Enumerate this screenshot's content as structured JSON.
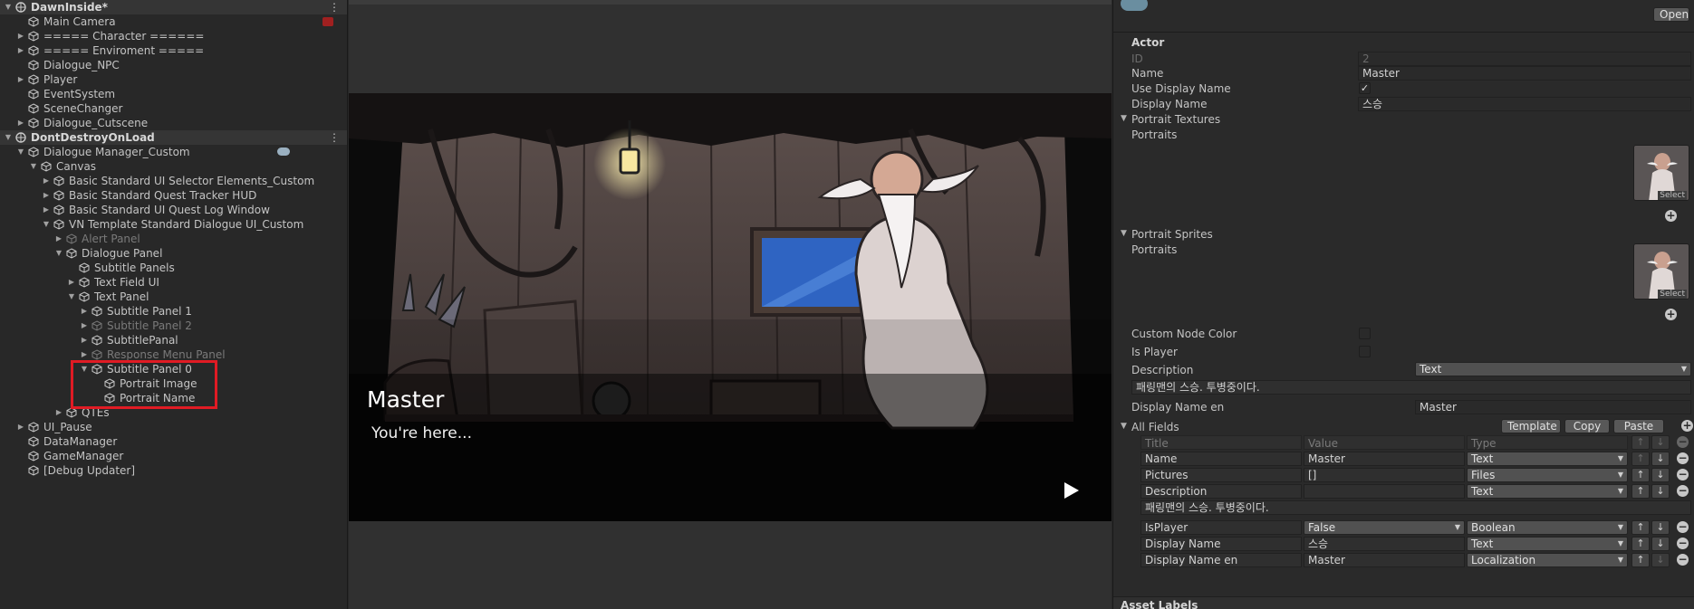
{
  "hierarchy": {
    "rows": [
      {
        "label": "DawnInside*",
        "indent": 0,
        "arrow": "▼",
        "scene": true,
        "bold": true,
        "menu": "⋮"
      },
      {
        "label": "Main Camera",
        "indent": 1,
        "arrow": "",
        "badge": true
      },
      {
        "label": "===== Character ======",
        "indent": 1,
        "arrow": "▶"
      },
      {
        "label": "===== Enviroment =====",
        "indent": 1,
        "arrow": "▶"
      },
      {
        "label": "Dialogue_NPC",
        "indent": 1,
        "arrow": ""
      },
      {
        "label": "Player",
        "indent": 1,
        "arrow": "▶"
      },
      {
        "label": "EventSystem",
        "indent": 1,
        "arrow": ""
      },
      {
        "label": "SceneChanger",
        "indent": 1,
        "arrow": ""
      },
      {
        "label": "Dialogue_Cutscene",
        "indent": 1,
        "arrow": "▶"
      },
      {
        "label": "DontDestroyOnLoad",
        "indent": 0,
        "arrow": "▼",
        "scene": true,
        "menu": "⋮"
      },
      {
        "label": "Dialogue Manager_Custom",
        "indent": 1,
        "arrow": "▼",
        "cloud": true
      },
      {
        "label": "Canvas",
        "indent": 2,
        "arrow": "▼"
      },
      {
        "label": "Basic Standard UI Selector Elements_Custom",
        "indent": 3,
        "arrow": "▶"
      },
      {
        "label": "Basic Standard Quest Tracker HUD",
        "indent": 3,
        "arrow": "▶"
      },
      {
        "label": "Basic Standard UI Quest Log Window",
        "indent": 3,
        "arrow": "▶"
      },
      {
        "label": "VN Template Standard Dialogue UI_Custom",
        "indent": 3,
        "arrow": "▼"
      },
      {
        "label": "Alert Panel",
        "indent": 4,
        "arrow": "▶",
        "dim": true
      },
      {
        "label": "Dialogue Panel",
        "indent": 4,
        "arrow": "▼"
      },
      {
        "label": "Subtitle Panels",
        "indent": 5,
        "arrow": ""
      },
      {
        "label": "Text Field UI",
        "indent": 5,
        "arrow": "▶"
      },
      {
        "label": "Text Panel",
        "indent": 5,
        "arrow": "▼"
      },
      {
        "label": "Subtitle Panel 1",
        "indent": 6,
        "arrow": "▶"
      },
      {
        "label": "Subtitle Panel 2",
        "indent": 6,
        "arrow": "▶",
        "dim": true
      },
      {
        "label": "SubtitlePanal",
        "indent": 6,
        "arrow": "▶"
      },
      {
        "label": "Response Menu Panel",
        "indent": 6,
        "arrow": "▶",
        "dim": true
      },
      {
        "label": "Subtitle Panel 0",
        "indent": 6,
        "arrow": "▼"
      },
      {
        "label": "Portrait Image",
        "indent": 7,
        "arrow": ""
      },
      {
        "label": "Portrait Name",
        "indent": 7,
        "arrow": ""
      },
      {
        "label": "QTEs",
        "indent": 4,
        "arrow": "▶"
      },
      {
        "label": "UI_Pause",
        "indent": 1,
        "arrow": "▶"
      },
      {
        "label": "DataManager",
        "indent": 1,
        "arrow": ""
      },
      {
        "label": "GameManager",
        "indent": 1,
        "arrow": ""
      },
      {
        "label": "[Debug Updater]",
        "indent": 1,
        "arrow": ""
      }
    ]
  },
  "game": {
    "speaker_name": "Master",
    "dialogue_line": "You're here...",
    "continue_icon": "play-icon"
  },
  "inspector": {
    "open_label": "Open",
    "section_actor": "Actor",
    "id_label": "ID",
    "id_value": "2",
    "name_label": "Name",
    "name_value": "Master",
    "use_display_name_label": "Use Display Name",
    "use_display_name_checked": "✓",
    "display_name_label": "Display Name",
    "display_name_value": "스승",
    "portrait_textures_label": "Portrait Textures",
    "portraits_label_1": "Portraits",
    "select_label_1": "Select",
    "portrait_sprites_label": "Portrait Sprites",
    "portraits_label_2": "Portraits",
    "select_label_2": "Select",
    "custom_node_color_label": "Custom Node Color",
    "is_player_label": "Is Player",
    "description_label": "Description",
    "description_type": "Text",
    "description_value": "패링맨의 스승. 투병중이다.",
    "display_name_en_label": "Display Name en",
    "display_name_en_value": "Master",
    "all_fields_label": "All Fields",
    "template_button": "Template",
    "copy_button": "Copy",
    "paste_button": "Paste",
    "columns": {
      "title": "Title",
      "value": "Value",
      "type": "Type"
    },
    "fields": [
      {
        "title": "Name",
        "value": "Master",
        "type": "Text"
      },
      {
        "title": "Pictures",
        "value": "[]",
        "type": "Files"
      },
      {
        "title": "Description",
        "value": "",
        "type": "Text",
        "extra": "패링맨의 스승. 투병중이다."
      },
      {
        "title": "IsPlayer",
        "value": "False",
        "type": "Boolean",
        "value_dropdown": true
      },
      {
        "title": "Display Name",
        "value": "스승",
        "type": "Text"
      },
      {
        "title": "Display Name en",
        "value": "Master",
        "type": "Localization"
      }
    ],
    "asset_labels": "Asset Labels"
  }
}
